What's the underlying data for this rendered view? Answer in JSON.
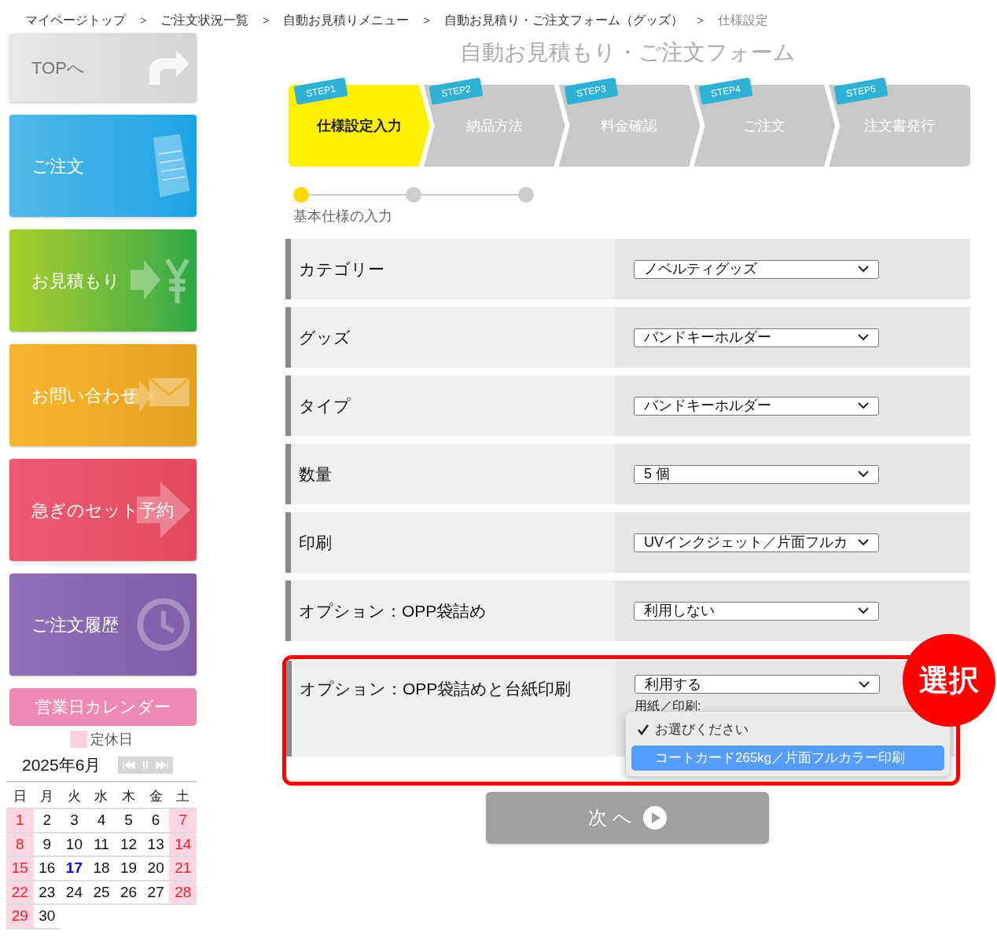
{
  "breadcrumb": [
    {
      "kind": "link",
      "label": "マイページトップ"
    },
    {
      "kind": "separator",
      "label": ">"
    },
    {
      "kind": "link",
      "label": "ご注文状況一覧"
    },
    {
      "kind": "separator",
      "label": ">"
    },
    {
      "kind": "link",
      "label": "自動お見積りメニュー"
    },
    {
      "kind": "separator",
      "label": ">"
    },
    {
      "kind": "link",
      "label": "自動お見積り・ご注文フォーム（グッズ）"
    },
    {
      "kind": "separator",
      "label": ">"
    },
    {
      "kind": "current",
      "label": "仕様設定"
    }
  ],
  "sidebar": {
    "buttons": [
      {
        "kind": "top",
        "label": "TOPへ"
      },
      {
        "kind": "order",
        "label": "ご注文"
      },
      {
        "kind": "estimate",
        "label": "お見積もり"
      },
      {
        "kind": "contact",
        "label": "お問い合わせ"
      },
      {
        "kind": "rush",
        "label": "急ぎのセット予約"
      },
      {
        "kind": "history",
        "label": "ご注文履歴"
      }
    ]
  },
  "calendar": {
    "title": "営業日カレンダー",
    "legend": "定休日",
    "month": "2025年6月",
    "weekdays": [
      "日",
      "月",
      "火",
      "水",
      "木",
      "金",
      "土"
    ],
    "days": [
      {
        "d": "1",
        "holiday": true,
        "today": false
      },
      {
        "d": "2",
        "holiday": false,
        "today": false
      },
      {
        "d": "3",
        "holiday": false,
        "today": false
      },
      {
        "d": "4",
        "holiday": false,
        "today": false
      },
      {
        "d": "5",
        "holiday": false,
        "today": false
      },
      {
        "d": "6",
        "holiday": false,
        "today": false
      },
      {
        "d": "7",
        "holiday": true,
        "today": false
      },
      {
        "d": "8",
        "holiday": true,
        "today": false
      },
      {
        "d": "9",
        "holiday": false,
        "today": false
      },
      {
        "d": "10",
        "holiday": false,
        "today": false
      },
      {
        "d": "11",
        "holiday": false,
        "today": false
      },
      {
        "d": "12",
        "holiday": false,
        "today": false
      },
      {
        "d": "13",
        "holiday": false,
        "today": false
      },
      {
        "d": "14",
        "holiday": true,
        "today": false
      },
      {
        "d": "15",
        "holiday": true,
        "today": false
      },
      {
        "d": "16",
        "holiday": false,
        "today": false
      },
      {
        "d": "17",
        "holiday": false,
        "today": true
      },
      {
        "d": "18",
        "holiday": false,
        "today": false
      },
      {
        "d": "19",
        "holiday": false,
        "today": false
      },
      {
        "d": "20",
        "holiday": false,
        "today": false
      },
      {
        "d": "21",
        "holiday": true,
        "today": false
      },
      {
        "d": "22",
        "holiday": true,
        "today": false
      },
      {
        "d": "23",
        "holiday": false,
        "today": false
      },
      {
        "d": "24",
        "holiday": false,
        "today": false
      },
      {
        "d": "25",
        "holiday": false,
        "today": false
      },
      {
        "d": "26",
        "holiday": false,
        "today": false
      },
      {
        "d": "27",
        "holiday": false,
        "today": false
      },
      {
        "d": "28",
        "holiday": true,
        "today": false
      },
      {
        "d": "29",
        "holiday": true,
        "today": false
      },
      {
        "d": "30",
        "holiday": false,
        "today": false
      }
    ]
  },
  "form": {
    "title": "自動お見積もり・ご注文フォーム",
    "steps": [
      {
        "badge": "STEP1",
        "label": "仕様設定入力",
        "selected": true
      },
      {
        "badge": "STEP2",
        "label": "納品方法",
        "selected": false
      },
      {
        "badge": "STEP3",
        "label": "料金確認",
        "selected": false
      },
      {
        "badge": "STEP4",
        "label": "ご注文",
        "selected": false
      },
      {
        "badge": "STEP5",
        "label": "注文書発行",
        "selected": false
      }
    ],
    "progress": {
      "label": "基本仕様の入力",
      "dots": [
        {
          "selected": true
        },
        {
          "selected": false
        },
        {
          "selected": false
        }
      ]
    },
    "rows": [
      {
        "label": "カテゴリー",
        "value": "ノベルティグッズ",
        "highlighted": false
      },
      {
        "label": "グッズ",
        "value": "バンドキーホルダー",
        "highlighted": false
      },
      {
        "label": "タイプ",
        "value": "バンドキーホルダー",
        "highlighted": false
      },
      {
        "label": "数量",
        "value": "5 個",
        "highlighted": false
      },
      {
        "label": "印刷",
        "value": "UVインクジェット／片面フルカ",
        "highlighted": false
      },
      {
        "label": "オプション：OPP袋詰め",
        "value": "利用しない",
        "highlighted": false
      },
      {
        "label": "オプション：OPP袋詰めと台紙印刷",
        "value": "利用する",
        "highlighted": true,
        "sub_label": "用紙／印刷:",
        "callout": "選択",
        "dropdown": [
          {
            "label": "お選びください",
            "checked": true,
            "selected": false
          },
          {
            "label": "コートカード265kg／片面フルカラー印刷",
            "checked": false,
            "selected": true
          }
        ]
      }
    ],
    "next_button": "次 へ"
  }
}
